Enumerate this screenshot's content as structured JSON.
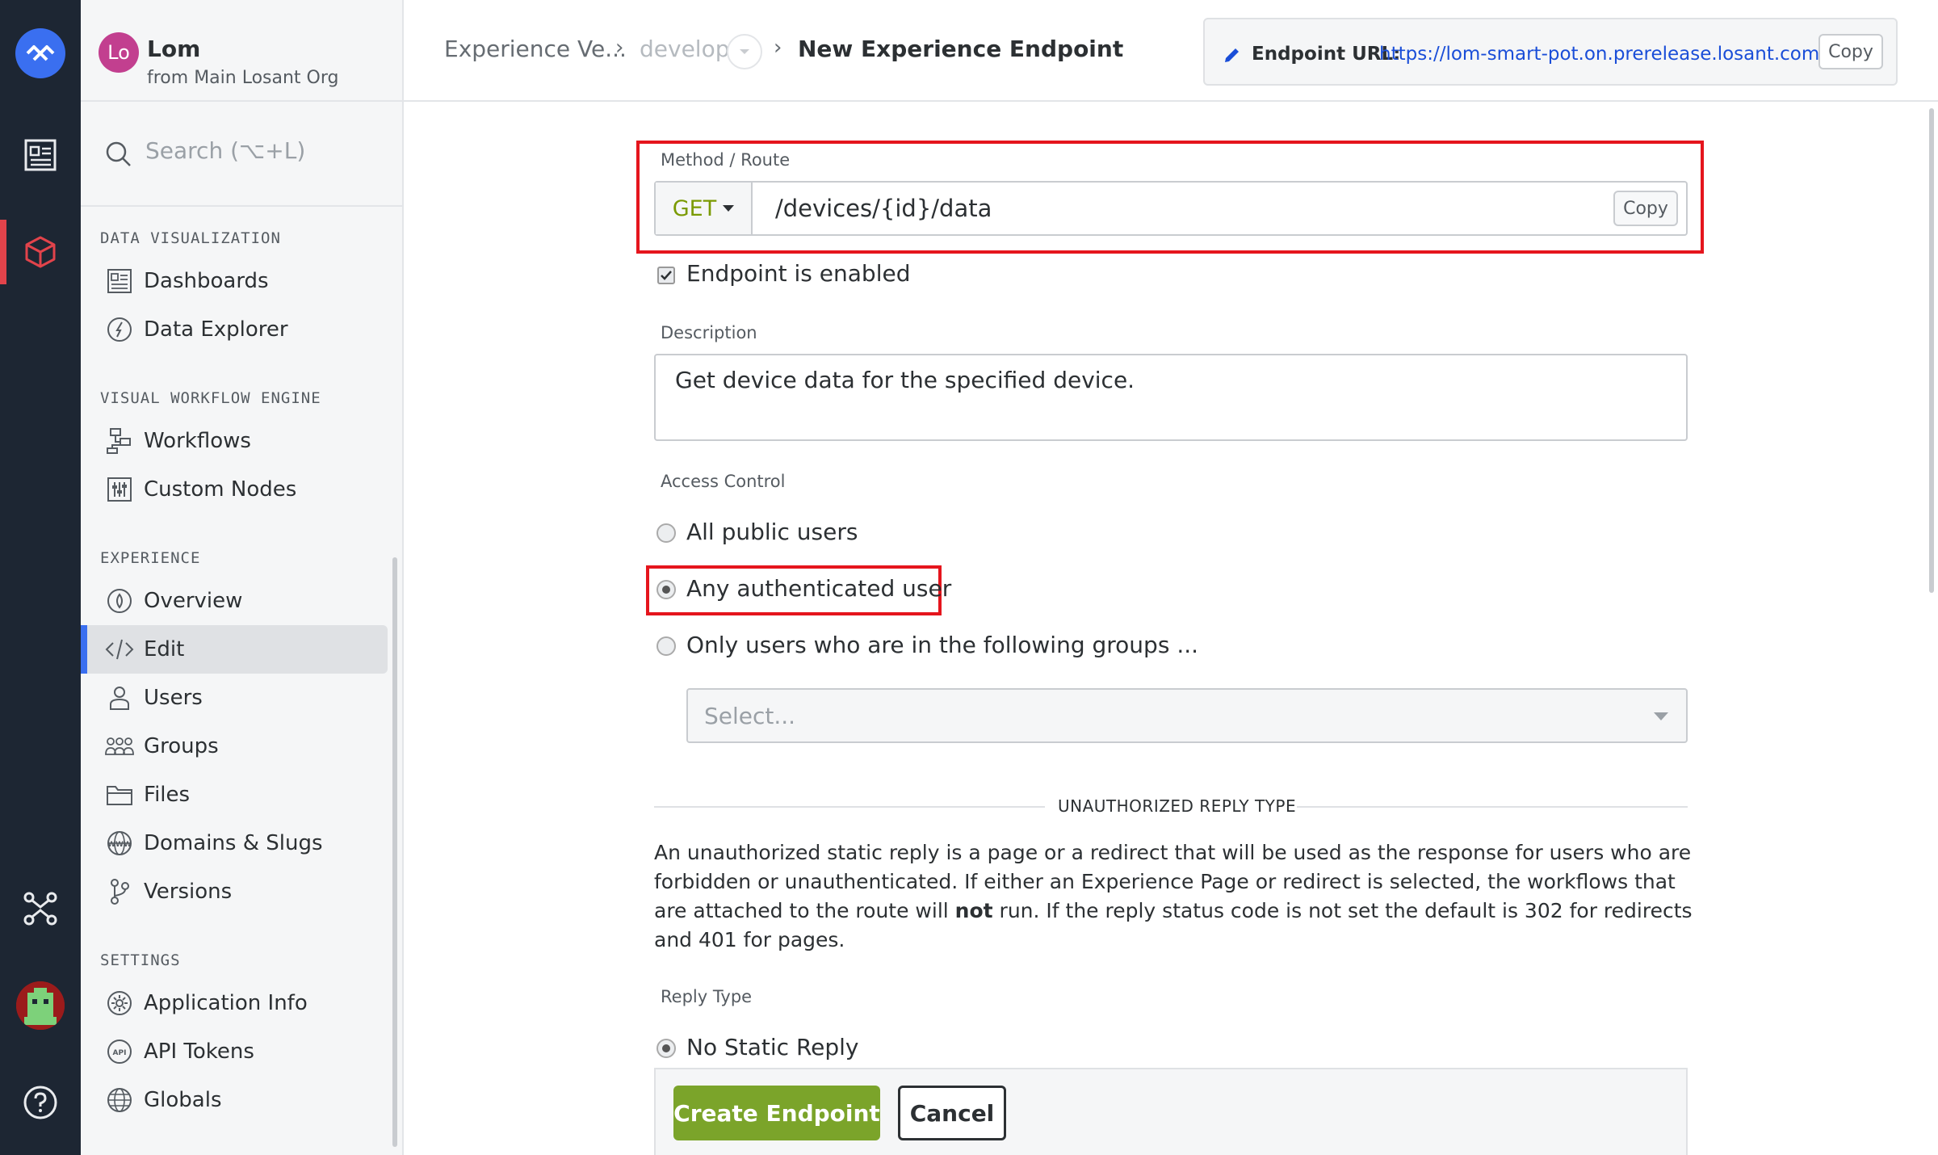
{
  "org": {
    "initials": "Lo",
    "name": "Lom",
    "subtitle": "from Main Losant Org"
  },
  "search": {
    "placeholder": "Search (⌥+L)"
  },
  "sidebar": {
    "sections": [
      {
        "title": "DATA VISUALIZATION",
        "items": [
          {
            "label": "Dashboards",
            "icon": "dashboard-icon"
          },
          {
            "label": "Data Explorer",
            "icon": "compass-icon"
          }
        ]
      },
      {
        "title": "VISUAL WORKFLOW ENGINE",
        "items": [
          {
            "label": "Workflows",
            "icon": "workflow-icon"
          },
          {
            "label": "Custom Nodes",
            "icon": "custom-nodes-icon"
          }
        ]
      },
      {
        "title": "EXPERIENCE",
        "items": [
          {
            "label": "Overview",
            "icon": "overview-icon"
          },
          {
            "label": "Edit",
            "icon": "code-icon",
            "active": true
          },
          {
            "label": "Users",
            "icon": "user-icon"
          },
          {
            "label": "Groups",
            "icon": "groups-icon"
          },
          {
            "label": "Files",
            "icon": "folder-icon"
          },
          {
            "label": "Domains & Slugs",
            "icon": "www-icon"
          },
          {
            "label": "Versions",
            "icon": "branch-icon"
          }
        ]
      },
      {
        "title": "SETTINGS",
        "items": [
          {
            "label": "Application Info",
            "icon": "gear-icon"
          },
          {
            "label": "API Tokens",
            "icon": "api-icon"
          },
          {
            "label": "Globals",
            "icon": "globe-icon"
          }
        ]
      }
    ]
  },
  "breadcrumb": {
    "items": [
      "Experience Ve...",
      "develop",
      "New Experience Endpoint"
    ],
    "separator": "›"
  },
  "endpoint_url": {
    "label": "Endpoint URL:",
    "value": "https://lom-smart-pot.on.prerelease.losant.com",
    "copy_label": "Copy"
  },
  "form": {
    "method_route_label": "Method / Route",
    "method": "GET",
    "route": "/devices/{id}/data",
    "route_copy_label": "Copy",
    "enabled_label": "Endpoint is enabled",
    "enabled": true,
    "description_label": "Description",
    "description": "Get device data for the specified device.",
    "access_control_label": "Access Control",
    "access_options": [
      "All public users",
      "Any authenticated user",
      "Only users who are in the following groups ..."
    ],
    "access_selected": "Any authenticated user",
    "groups_placeholder": "Select...",
    "unauth_title": "UNAUTHORIZED REPLY TYPE",
    "unauth_para_1": "An unauthorized static reply is a page or a redirect that will be used as the response for users who are forbidden or unauthenticated. If either an Experience Page or redirect is selected, the workflows that are attached to the route will ",
    "unauth_para_bold": "not",
    "unauth_para_2": " run. If the reply status code is not set the default is 302 for redirects and 401 for pages.",
    "reply_type_label": "Reply Type",
    "reply_option": "No Static Reply",
    "create_label": "Create Endpoint",
    "cancel_label": "Cancel"
  },
  "colors": {
    "rail_bg": "#1d2633",
    "accent": "#3a6ff0",
    "highlight": "#e5151d",
    "primary_button": "#7ba42a",
    "method": "#7a9a01",
    "link": "#1a4ed8"
  }
}
